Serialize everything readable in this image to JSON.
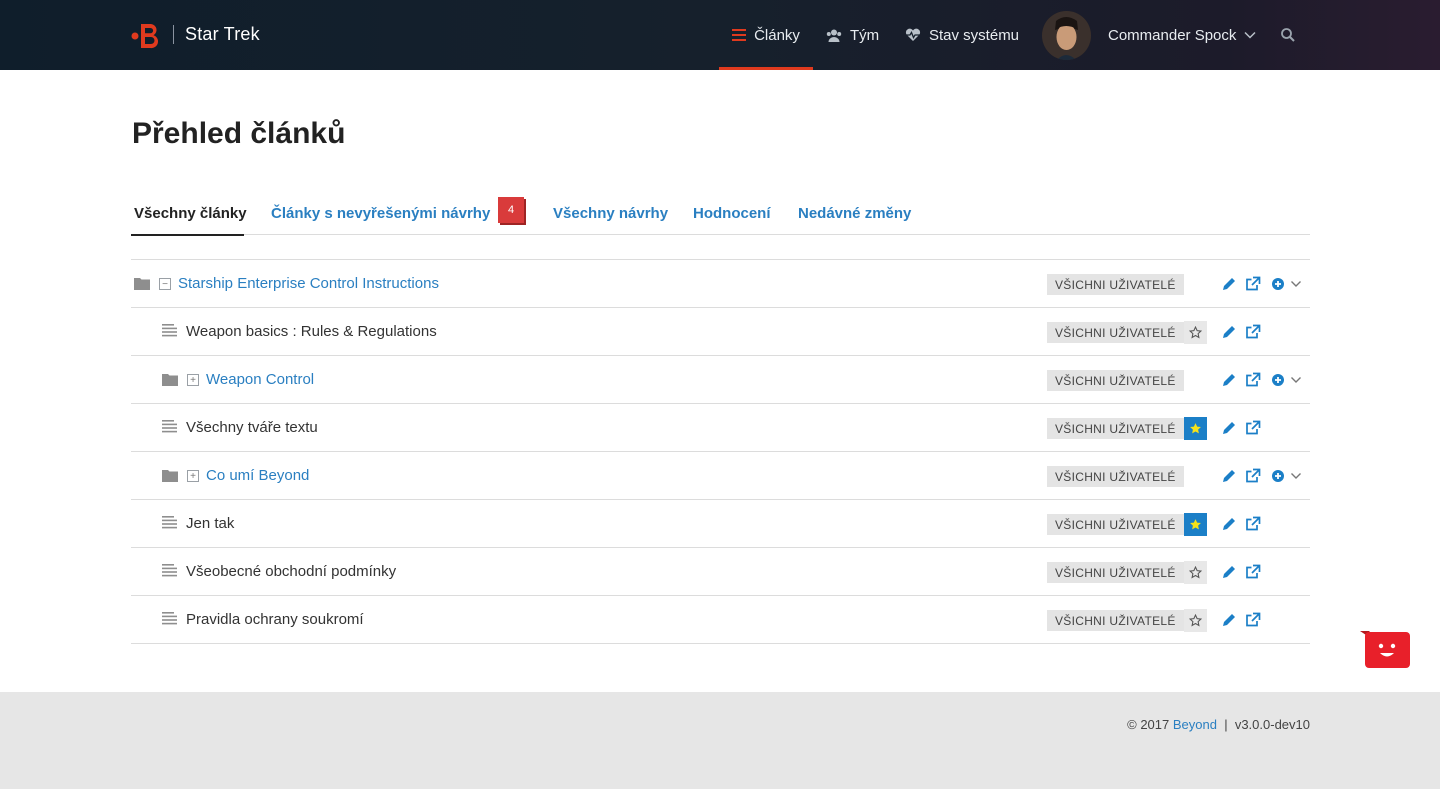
{
  "colors": {
    "accent": "#e03a1e",
    "link": "#2a7fc1",
    "badge": "#d93b3b",
    "star_on": "#1b7fc7"
  },
  "header": {
    "brand": "Star Trek",
    "nav": [
      {
        "label": "Články",
        "icon": "list-icon",
        "active": true
      },
      {
        "label": "Tým",
        "icon": "users-icon"
      },
      {
        "label": "Stav systému",
        "icon": "heartbeat-icon"
      }
    ],
    "user_name": "Commander Spock"
  },
  "main": {
    "title": "Přehled článků",
    "tabs": [
      {
        "label": "Všechny články",
        "active": true
      },
      {
        "label": "Články s nevyřešenými návrhy",
        "badge": "4"
      },
      {
        "label": "Všechny návrhy"
      },
      {
        "label": "Hodnocení"
      },
      {
        "label": "Nedávné změny"
      }
    ],
    "tree": [
      {
        "type": "folder",
        "level": 0,
        "expanded": true,
        "label": "Starship Enterprise Control Instructions",
        "visibility": "VŠICHNI UŽIVATELÉ"
      },
      {
        "type": "article",
        "level": 1,
        "label": "Weapon basics : Rules & Regulations",
        "visibility": "VŠICHNI UŽIVATELÉ",
        "starred": false
      },
      {
        "type": "folder",
        "level": 1,
        "expanded": false,
        "label": "Weapon Control",
        "visibility": "VŠICHNI UŽIVATELÉ"
      },
      {
        "type": "article",
        "level": 1,
        "label": "Všechny tváře textu",
        "visibility": "VŠICHNI UŽIVATELÉ",
        "starred": true
      },
      {
        "type": "folder",
        "level": 1,
        "expanded": false,
        "label": "Co umí Beyond",
        "visibility": "VŠICHNI UŽIVATELÉ"
      },
      {
        "type": "article",
        "level": 1,
        "label": "Jen tak",
        "visibility": "VŠICHNI UŽIVATELÉ",
        "starred": true
      },
      {
        "type": "article",
        "level": 1,
        "label": "Všeobecné obchodní podmínky",
        "visibility": "VŠICHNI UŽIVATELÉ",
        "starred": false
      },
      {
        "type": "article",
        "level": 1,
        "label": "Pravidla ochrany soukromí",
        "visibility": "VŠICHNI UŽIVATELÉ",
        "starred": false
      }
    ]
  },
  "footer": {
    "copyright": "© 2017",
    "product": "Beyond",
    "separator": "|",
    "version": "v3.0.0-dev10"
  }
}
